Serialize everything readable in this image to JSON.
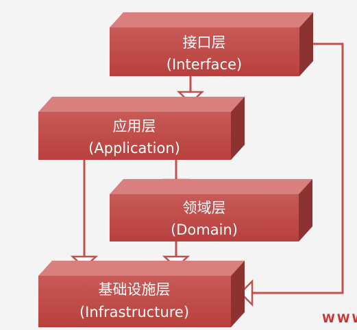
{
  "diagram": {
    "layers": [
      {
        "id": "interface",
        "name_zh": "接口层",
        "name_en": "(Interface)"
      },
      {
        "id": "application",
        "name_zh": "应用层",
        "name_en": "(Application)"
      },
      {
        "id": "domain",
        "name_zh": "领域层",
        "name_en": "(Domain)"
      },
      {
        "id": "infrastructure",
        "name_zh": "基础设施层",
        "name_en": "(Infrastructure)"
      }
    ],
    "dependencies": [
      {
        "from": "interface",
        "to": "application"
      },
      {
        "from": "interface",
        "to": "infrastructure"
      },
      {
        "from": "application",
        "to": "domain"
      },
      {
        "from": "application",
        "to": "infrastructure"
      },
      {
        "from": "domain",
        "to": "infrastructure"
      }
    ]
  },
  "watermark": "WWW",
  "colors": {
    "box_front": "#c0504d",
    "box_top": "#d9807e",
    "box_side": "#8c3230",
    "line": "#c0504d",
    "text": "#ffffff",
    "watermark": "#cc3333"
  }
}
